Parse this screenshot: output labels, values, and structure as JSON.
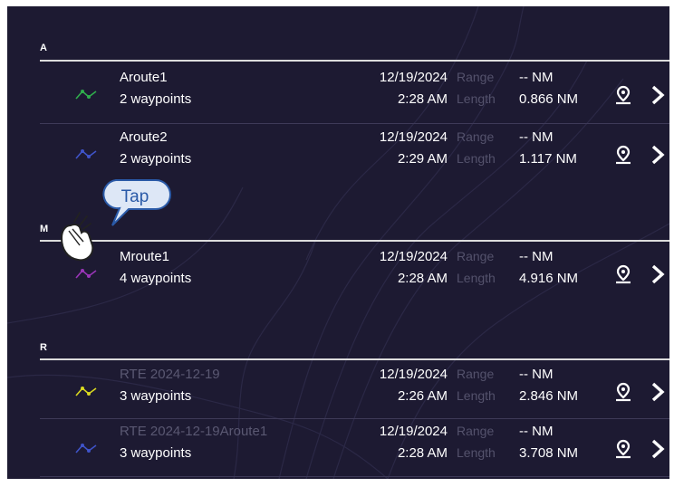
{
  "sections": [
    {
      "letter": "A",
      "routes": [
        {
          "name": "Aroute1",
          "waypoints": "2 waypoints",
          "date": "12/19/2024",
          "time": "2:28 AM",
          "range_label": "Range",
          "range_value": "-- NM",
          "length_label": "Length",
          "length_value": "0.866 NM",
          "color": "#2fae4c",
          "name_dim": false
        },
        {
          "name": "Aroute2",
          "waypoints": "2 waypoints",
          "date": "12/19/2024",
          "time": "2:29 AM",
          "range_label": "Range",
          "range_value": "-- NM",
          "length_label": "Length",
          "length_value": "1.117 NM",
          "color": "#3f53c8",
          "name_dim": false
        }
      ]
    },
    {
      "letter": "M",
      "routes": [
        {
          "name": "Mroute1",
          "waypoints": "4 waypoints",
          "date": "12/19/2024",
          "time": "2:28 AM",
          "range_label": "Range",
          "range_value": "-- NM",
          "length_label": "Length",
          "length_value": "4.916 NM",
          "color": "#9a35b8",
          "name_dim": false
        }
      ]
    },
    {
      "letter": "R",
      "routes": [
        {
          "name": "RTE 2024-12-19",
          "waypoints": "3 waypoints",
          "date": "12/19/2024",
          "time": "2:26 AM",
          "range_label": "Range",
          "range_value": "-- NM",
          "length_label": "Length",
          "length_value": "2.846 NM",
          "color": "#d8d820",
          "name_dim": true
        },
        {
          "name": "RTE 2024-12-19Aroute1",
          "waypoints": "3 waypoints",
          "date": "12/19/2024",
          "time": "2:28 AM",
          "range_label": "Range",
          "range_value": "-- NM",
          "length_label": "Length",
          "length_value": "3.708 NM",
          "color": "#3f53c8",
          "name_dim": true
        }
      ]
    }
  ],
  "annotation": {
    "text": "Tap",
    "color": "#2a5aa8"
  },
  "icons": {
    "route": "route-line-icon",
    "pin": "map-pin-icon",
    "chevron": "chevron-right-icon",
    "hand": "tapping-hand-icon"
  },
  "colors": {
    "background": "#1d1a32",
    "text": "#ffffff",
    "label": "#54526c",
    "divider": "#dcdcdc"
  }
}
